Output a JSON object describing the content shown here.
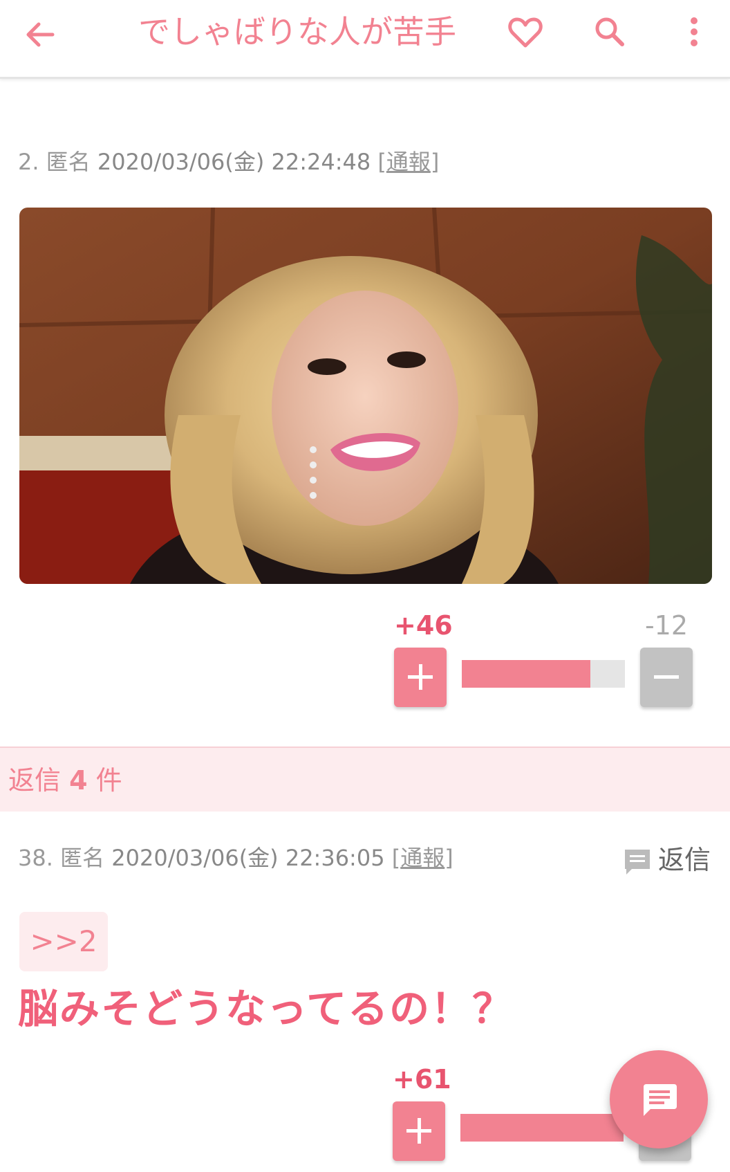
{
  "header": {
    "title": "でしゃばりな人が苦手"
  },
  "post": {
    "number": "2.",
    "author": "匿名",
    "date": "2020/03/06(金) 22:24:48",
    "report_label": "通報",
    "image_alt": "",
    "votes": {
      "plus": "+46",
      "minus": "-12",
      "plus_fraction": 0.79
    }
  },
  "replies_band": {
    "prefix": "返信",
    "count": "4",
    "suffix": "件"
  },
  "reply": {
    "number": "38.",
    "author": "匿名",
    "date": "2020/03/06(金) 22:36:05",
    "report_label": "通報",
    "reply_action_label": "返信",
    "anchor": ">>2",
    "body": "脳みそどうなってるの！？",
    "votes": {
      "plus": "+61",
      "plus_fraction": 1.0
    }
  },
  "colors": {
    "accent": "#f28291",
    "accent_strong": "#e8546f",
    "band": "#fdecee",
    "minus": "#c2c2c2"
  },
  "icons": [
    "back-arrow-icon",
    "heart-icon",
    "search-icon",
    "more-vert-icon",
    "comment-icon",
    "chat-icon"
  ]
}
